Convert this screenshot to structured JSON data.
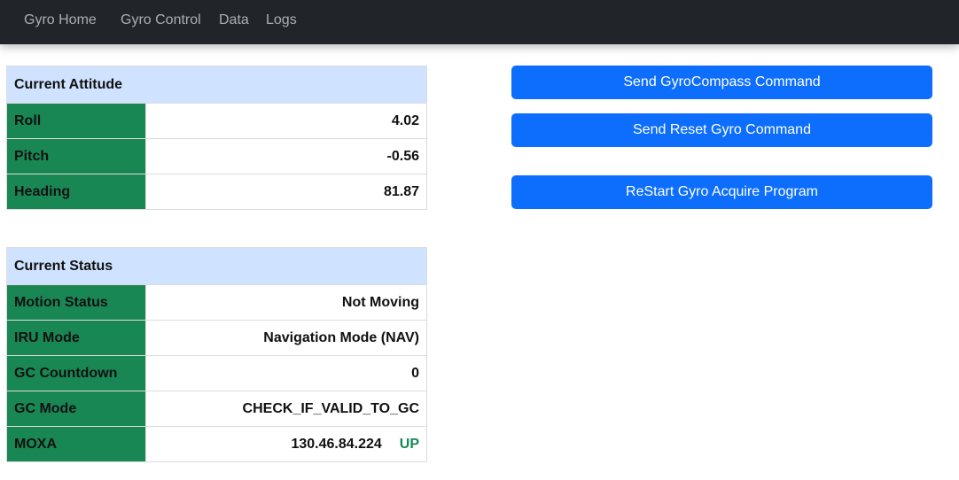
{
  "nav": {
    "brand": "Gyro Home",
    "links": [
      "Gyro Control",
      "Data",
      "Logs"
    ]
  },
  "attitude": {
    "title": "Current Attitude",
    "rows": [
      {
        "label": "Roll",
        "value": "4.02"
      },
      {
        "label": "Pitch",
        "value": "-0.56"
      },
      {
        "label": "Heading",
        "value": "81.87"
      }
    ]
  },
  "status": {
    "title": "Current Status",
    "rows": [
      {
        "label": "Motion Status",
        "value": "Not Moving"
      },
      {
        "label": "IRU Mode",
        "value": "Navigation Mode (NAV)"
      },
      {
        "label": "GC Countdown",
        "value": "0"
      },
      {
        "label": "GC Mode",
        "value": "CHECK_IF_VALID_TO_GC"
      }
    ],
    "moxa": {
      "label": "MOXA",
      "ip": "130.46.84.224",
      "state": "UP"
    }
  },
  "commands": {
    "gyrocompass": "Send GyroCompass Command",
    "reset": "Send Reset Gyro Command",
    "restart": "ReStart Gyro Acquire Program"
  },
  "colors": {
    "navbar": "#212529",
    "header_bg": "#cfe2ff",
    "label_bg": "#198754",
    "button": "#0d6efd",
    "status_up": "#198754"
  }
}
